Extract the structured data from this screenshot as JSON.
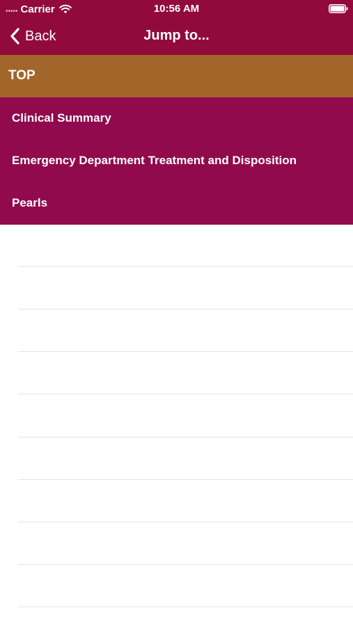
{
  "status_bar": {
    "carrier": "Carrier",
    "time": "10:56 AM",
    "signal_icon": "signal-dots-icon",
    "wifi_icon": "wifi-icon",
    "battery_icon": "battery-icon"
  },
  "nav": {
    "back_label": "Back",
    "title": "Jump to..."
  },
  "jump_list": {
    "top_label": "TOP",
    "sections": [
      "Clinical Summary",
      "Emergency Department Treatment and Disposition",
      "Pearls"
    ]
  },
  "colors": {
    "nav_background": "#920a3c",
    "top_row_background": "#a2652a",
    "section_background": "#920a4e",
    "text": "#ffffff"
  }
}
